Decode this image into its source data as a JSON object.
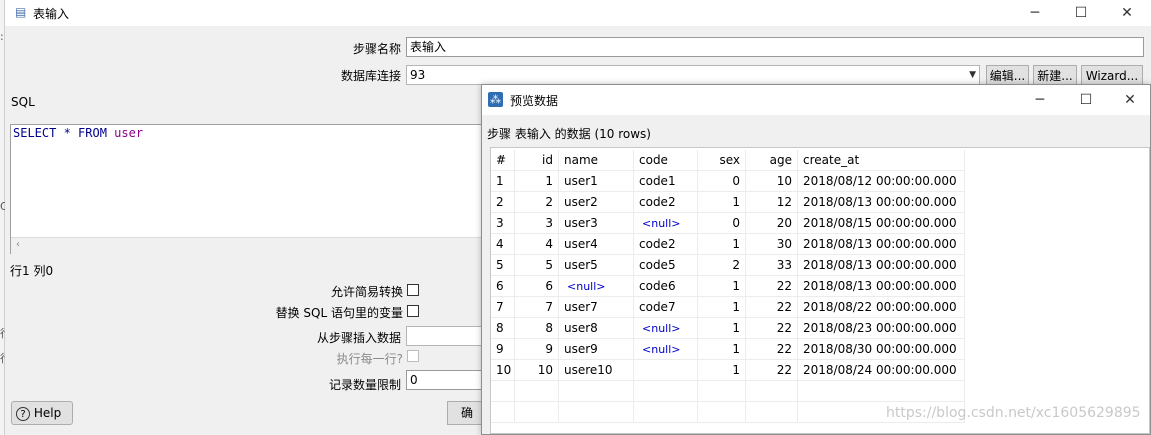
{
  "main_dialog": {
    "title": "表输入",
    "step_name_label": "步骤名称",
    "step_name_value": "表输入",
    "db_conn_label": "数据库连接",
    "db_conn_value": "93",
    "edit_btn": "编辑...",
    "new_btn": "新建...",
    "wizard_btn": "Wizard...",
    "sql_label": "SQL",
    "sql_select": "SELECT * FROM",
    "sql_table": "user",
    "cursor_pos": "行1 列0",
    "allow_lazy_label": "允许简易转换",
    "replace_vars_label": "替换 SQL 语句里的变量",
    "insert_from_step_label": "从步骤插入数据",
    "exec_each_row_label": "执行每一行?",
    "record_limit_label": "记录数量限制",
    "record_limit_value": "0",
    "help_btn": "Help",
    "ok_btn_partial": "确"
  },
  "preview_dialog": {
    "title": "预览数据",
    "subtitle": "步骤 表输入 的数据 (10 rows)",
    "columns": [
      "#",
      "id",
      "name",
      "code",
      "sex",
      "age",
      "create_at"
    ],
    "rows": [
      [
        "1",
        "1",
        "user1",
        "code1",
        "0",
        "10",
        "2018/08/12 00:00:00.000"
      ],
      [
        "2",
        "2",
        "user2",
        "code2",
        "1",
        "12",
        "2018/08/13 00:00:00.000"
      ],
      [
        "3",
        "3",
        "user3",
        "<null>",
        "0",
        "20",
        "2018/08/15 00:00:00.000"
      ],
      [
        "4",
        "4",
        "user4",
        "code2",
        "1",
        "30",
        "2018/08/13 00:00:00.000"
      ],
      [
        "5",
        "5",
        "user5",
        "code5",
        "2",
        "33",
        "2018/08/13 00:00:00.000"
      ],
      [
        "6",
        "6",
        "<null>",
        "code6",
        "1",
        "22",
        "2018/08/13 00:00:00.000"
      ],
      [
        "7",
        "7",
        "user7",
        "code7",
        "1",
        "22",
        "2018/08/22 00:00:00.000"
      ],
      [
        "8",
        "8",
        "user8",
        "<null>",
        "1",
        "22",
        "2018/08/23 00:00:00.000"
      ],
      [
        "9",
        "9",
        "user9",
        "<null>",
        "1",
        "22",
        "2018/08/30 00:00:00.000"
      ],
      [
        "10",
        "10",
        "usere10",
        "",
        "1",
        "22",
        "2018/08/24 00:00:00.000"
      ]
    ],
    "null_text": "<null>"
  },
  "watermark": "https://blog.csdn.net/xc1605629895",
  "colors": {
    "sql_keyword": "#00008b",
    "sql_table": "#8b008b",
    "null_value": "#0000cc"
  }
}
